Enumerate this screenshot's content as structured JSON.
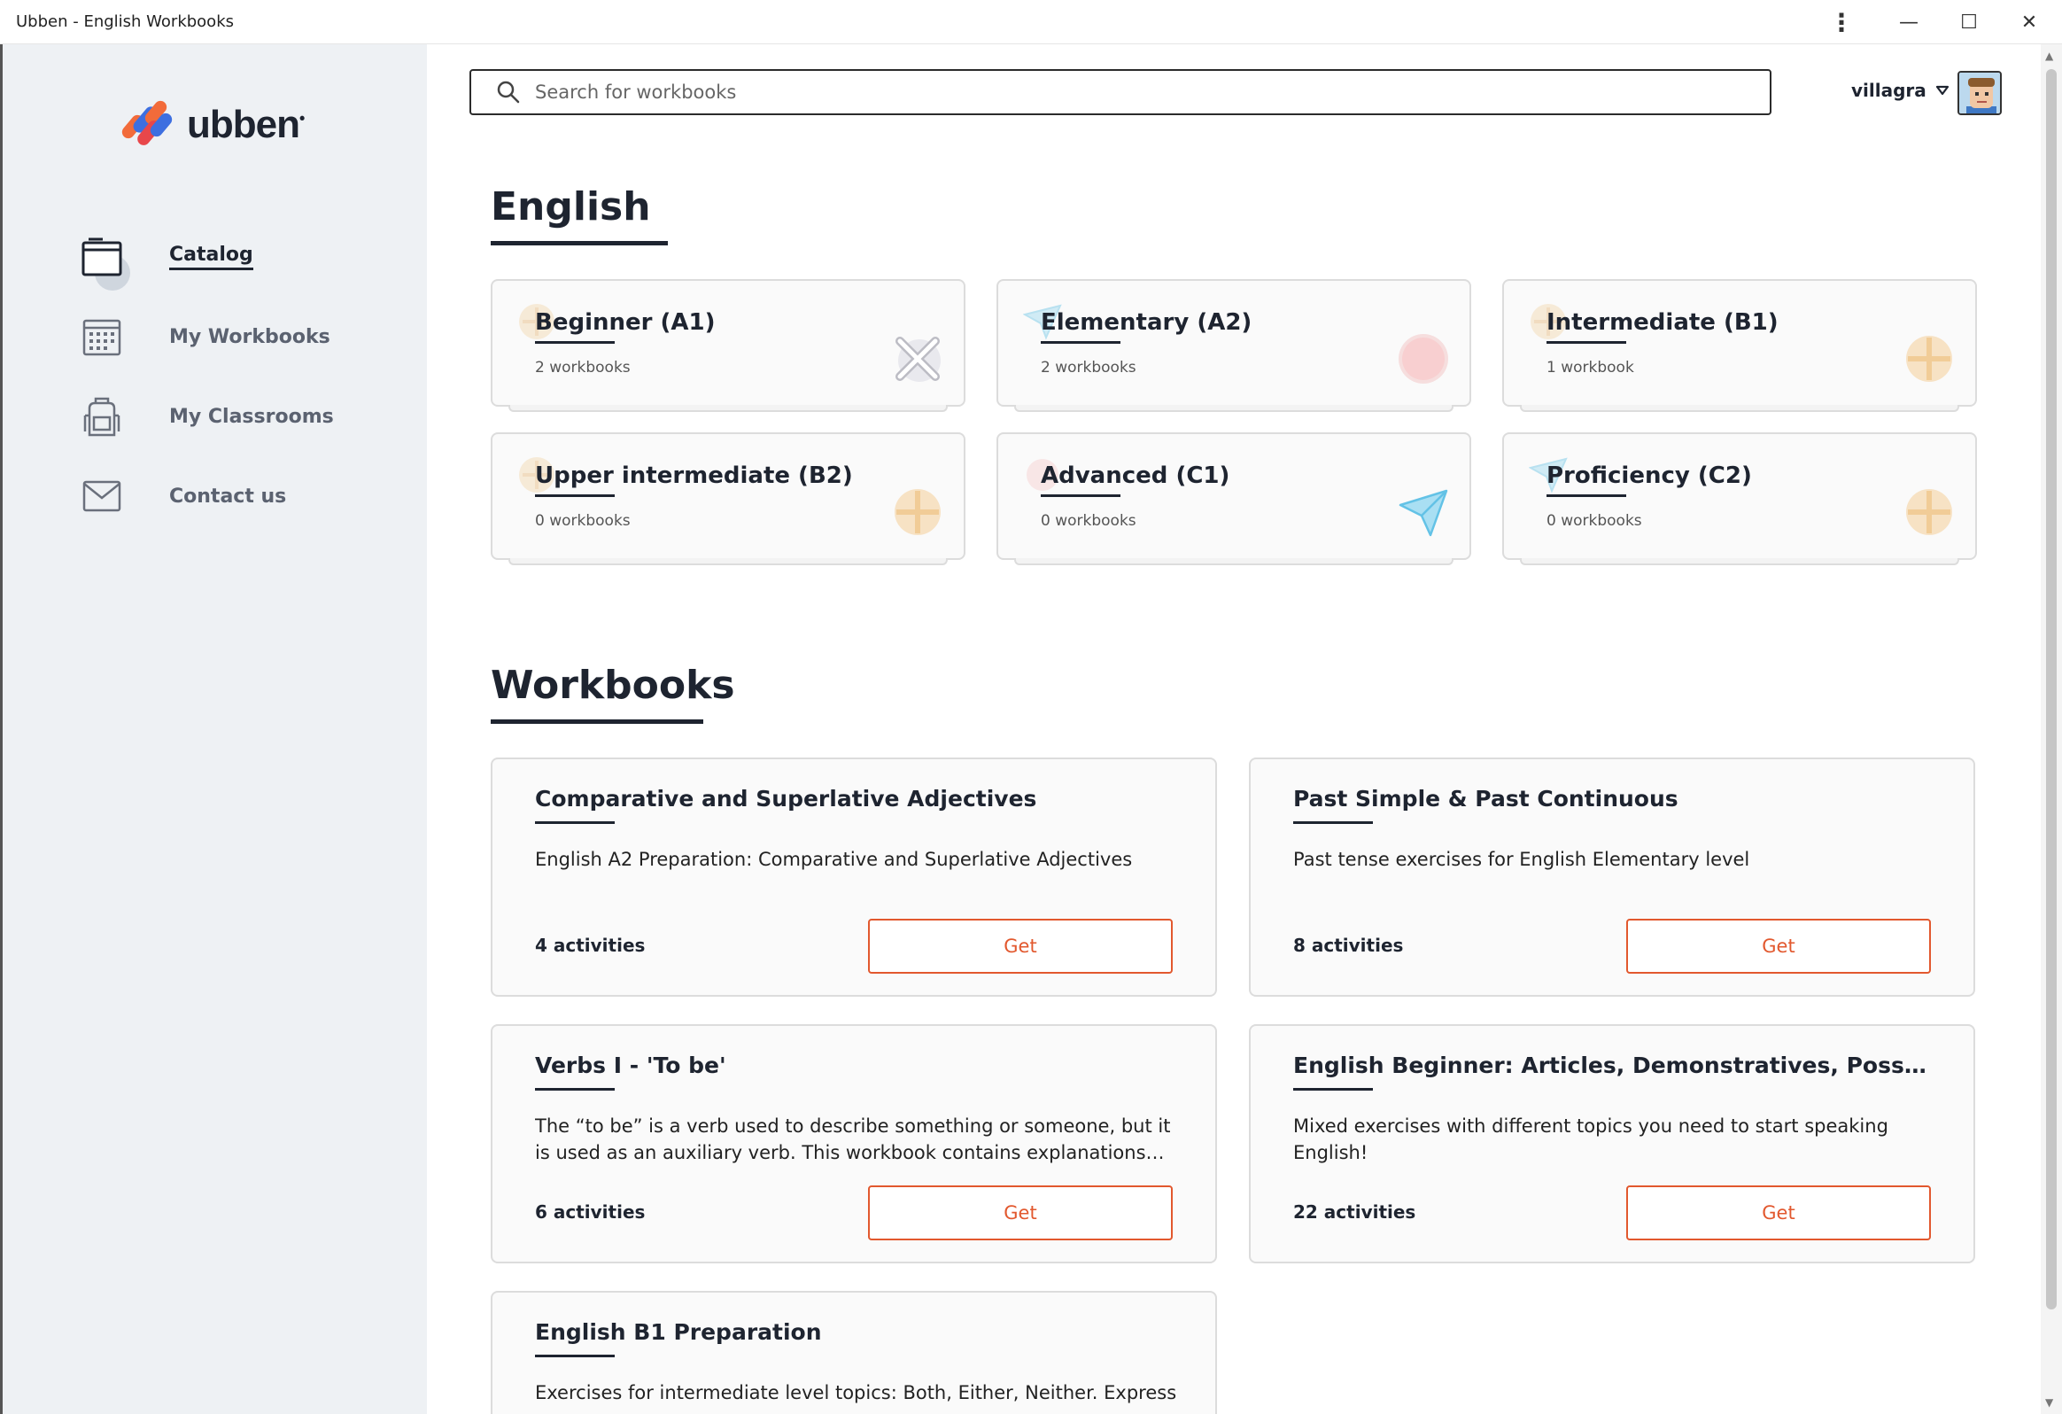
{
  "window": {
    "title": "Ubben - English Workbooks",
    "controls": {
      "more": "⋮",
      "minimize": "—",
      "maximize": "☐",
      "close": "✕"
    }
  },
  "brand": {
    "name": "ubben",
    "mark": "•",
    "colors": {
      "orange": "#f26b3a",
      "blue": "#3d6fe0",
      "red": "#e8474a"
    }
  },
  "sidebar": {
    "items": [
      {
        "label": "Catalog",
        "icon": "catalog-folder-icon",
        "active": true
      },
      {
        "label": "My Workbooks",
        "icon": "calendar-icon",
        "active": false
      },
      {
        "label": "My Classrooms",
        "icon": "backpack-icon",
        "active": false
      },
      {
        "label": "Contact us",
        "icon": "envelope-icon",
        "active": false
      }
    ]
  },
  "header": {
    "search_placeholder": "Search for workbooks",
    "username": "villagra"
  },
  "english": {
    "title": "English",
    "levels": [
      {
        "title": "Beginner (A1)",
        "count": "2 workbooks",
        "icon": "cross-icon"
      },
      {
        "title": "Elementary (A2)",
        "count": "2 workbooks",
        "icon": "circle-icon"
      },
      {
        "title": "Intermediate (B1)",
        "count": "1 workbook",
        "icon": "plus-icon"
      },
      {
        "title": "Upper intermediate (B2)",
        "count": "0 workbooks",
        "icon": "plus-icon"
      },
      {
        "title": "Advanced (C1)",
        "count": "0 workbooks",
        "icon": "paper-plane-icon"
      },
      {
        "title": "Proficiency (C2)",
        "count": "0 workbooks",
        "icon": "plus-icon"
      }
    ]
  },
  "workbooks": {
    "title": "Workbooks",
    "items": [
      {
        "title": "Comparative and Superlative Adjectives",
        "desc": "English A2 Preparation: Comparative and Superlative Adjectives",
        "activities": "4 activities",
        "button": "Get"
      },
      {
        "title": "Past Simple & Past Continuous",
        "desc": "Past tense exercises for English Elementary level",
        "activities": "8 activities",
        "button": "Get"
      },
      {
        "title": "Verbs I - 'To be'",
        "desc": "The “to be” is a verb used to describe something or someone, but it is used as an auxiliary verb. This workbook contains explanations…",
        "activities": "6 activities",
        "button": "Get"
      },
      {
        "title": "English Beginner: Articles, Demonstratives, Possessive Ad...",
        "desc": "Mixed exercises with different topics you need to start speaking English!",
        "activities": "22 activities",
        "button": "Get"
      },
      {
        "title": "English B1 Preparation",
        "desc": "Exercises for intermediate level topics: Both, Either, Neither. Express",
        "activities": "",
        "button": ""
      }
    ]
  }
}
